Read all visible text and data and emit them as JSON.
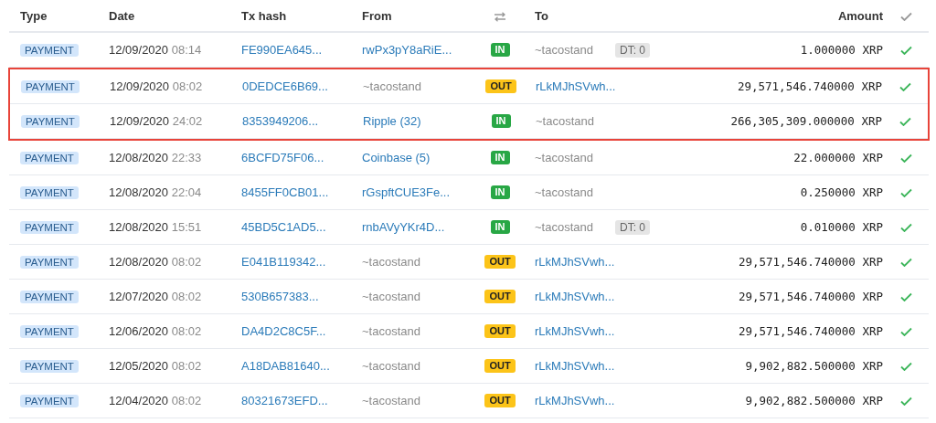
{
  "columns": {
    "type": "Type",
    "date": "Date",
    "hash": "Tx hash",
    "from": "From",
    "to": "To",
    "amount": "Amount"
  },
  "rows": [
    {
      "type": "PAYMENT",
      "date": "12/09/2020",
      "time": "08:14",
      "hash": "FE990EA645...",
      "from": "rwPx3pY8aRiE...",
      "from_link": true,
      "direction": "IN",
      "kind": "in",
      "to": "~tacostand",
      "to_link": false,
      "tag": "DT: 0",
      "amount": "1.000000 XRP",
      "highlighted": false
    },
    {
      "type": "PAYMENT",
      "date": "12/09/2020",
      "time": "08:02",
      "hash": "0DEDCE6B69...",
      "from": "~tacostand",
      "from_link": false,
      "direction": "OUT",
      "kind": "out",
      "to": "rLkMJhSVwh...",
      "to_link": true,
      "amount": "29,571,546.740000 XRP",
      "highlighted": true
    },
    {
      "type": "PAYMENT",
      "date": "12/09/2020",
      "time": "24:02",
      "hash": "8353949206...",
      "from": "Ripple (32)",
      "from_link": true,
      "direction": "IN",
      "kind": "in",
      "to": "~tacostand",
      "to_link": false,
      "amount": "266,305,309.000000 XRP",
      "highlighted": true
    },
    {
      "type": "PAYMENT",
      "date": "12/08/2020",
      "time": "22:33",
      "hash": "6BCFD75F06...",
      "from": "Coinbase (5)",
      "from_link": true,
      "direction": "IN",
      "kind": "in",
      "to": "~tacostand",
      "to_link": false,
      "amount": "22.000000 XRP",
      "highlighted": false
    },
    {
      "type": "PAYMENT",
      "date": "12/08/2020",
      "time": "22:04",
      "hash": "8455FF0CB01...",
      "from": "rGspftCUE3Fe...",
      "from_link": true,
      "direction": "IN",
      "kind": "in",
      "to": "~tacostand",
      "to_link": false,
      "amount": "0.250000 XRP",
      "highlighted": false
    },
    {
      "type": "PAYMENT",
      "date": "12/08/2020",
      "time": "15:51",
      "hash": "45BD5C1AD5...",
      "from": "rnbAVyYKr4D...",
      "from_link": true,
      "direction": "IN",
      "kind": "in",
      "to": "~tacostand",
      "to_link": false,
      "tag": "DT: 0",
      "amount": "0.010000 XRP",
      "highlighted": false
    },
    {
      "type": "PAYMENT",
      "date": "12/08/2020",
      "time": "08:02",
      "hash": "E041B119342...",
      "from": "~tacostand",
      "from_link": false,
      "direction": "OUT",
      "kind": "out",
      "to": "rLkMJhSVwh...",
      "to_link": true,
      "amount": "29,571,546.740000 XRP",
      "highlighted": false
    },
    {
      "type": "PAYMENT",
      "date": "12/07/2020",
      "time": "08:02",
      "hash": "530B657383...",
      "from": "~tacostand",
      "from_link": false,
      "direction": "OUT",
      "kind": "out",
      "to": "rLkMJhSVwh...",
      "to_link": true,
      "amount": "29,571,546.740000 XRP",
      "highlighted": false
    },
    {
      "type": "PAYMENT",
      "date": "12/06/2020",
      "time": "08:02",
      "hash": "DA4D2C8C5F...",
      "from": "~tacostand",
      "from_link": false,
      "direction": "OUT",
      "kind": "out",
      "to": "rLkMJhSVwh...",
      "to_link": true,
      "amount": "29,571,546.740000 XRP",
      "highlighted": false
    },
    {
      "type": "PAYMENT",
      "date": "12/05/2020",
      "time": "08:02",
      "hash": "A18DAB81640...",
      "from": "~tacostand",
      "from_link": false,
      "direction": "OUT",
      "kind": "out",
      "to": "rLkMJhSVwh...",
      "to_link": true,
      "amount": "9,902,882.500000 XRP",
      "highlighted": false
    },
    {
      "type": "PAYMENT",
      "date": "12/04/2020",
      "time": "08:02",
      "hash": "80321673EFD...",
      "from": "~tacostand",
      "from_link": false,
      "direction": "OUT",
      "kind": "out",
      "to": "rLkMJhSVwh...",
      "to_link": true,
      "amount": "9,902,882.500000 XRP",
      "highlighted": false
    }
  ]
}
